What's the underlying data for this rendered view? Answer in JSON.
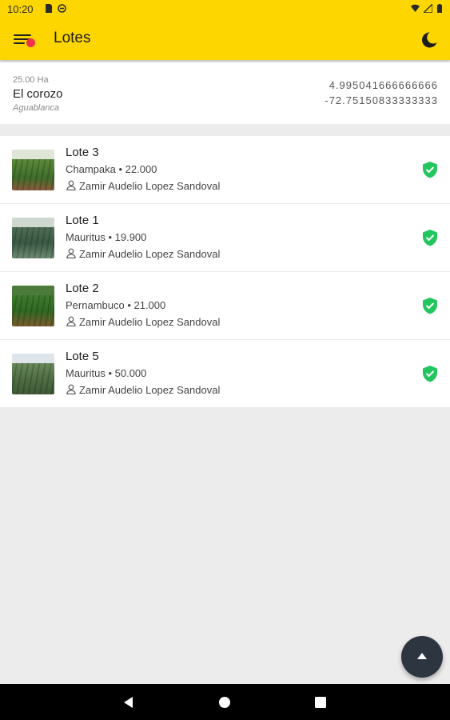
{
  "status_bar": {
    "time": "10:20"
  },
  "app_bar": {
    "title": "Lotes"
  },
  "farm": {
    "area": "25.00 Ha",
    "name": "El corozo",
    "region": "Aguablanca",
    "latitude": "4.995041666666666",
    "longitude": "-72.75150833333333"
  },
  "lots": [
    {
      "name": "Lote 3",
      "meta": "Champaka • 22.000",
      "owner": "Zamir Audelio Lopez Sandoval",
      "verified": true
    },
    {
      "name": "Lote 1",
      "meta": "Mauritus • 19.900",
      "owner": "Zamir Audelio Lopez Sandoval",
      "verified": true
    },
    {
      "name": "Lote 2",
      "meta": "Pernambuco • 21.000",
      "owner": "Zamir Audelio Lopez Sandoval",
      "verified": true
    },
    {
      "name": "Lote 5",
      "meta": "Mauritus • 50.000",
      "owner": "Zamir Audelio Lopez Sandoval",
      "verified": true
    }
  ],
  "colors": {
    "accent": "#fdd600",
    "badge": "#f0324a",
    "verified": "#22c55e",
    "fab": "#2c3540"
  },
  "icons": [
    "menu-icon",
    "notification-dot",
    "moon-icon",
    "person-icon",
    "verified-shield-icon",
    "arrow-up-icon",
    "back-icon",
    "home-icon",
    "recents-icon"
  ]
}
